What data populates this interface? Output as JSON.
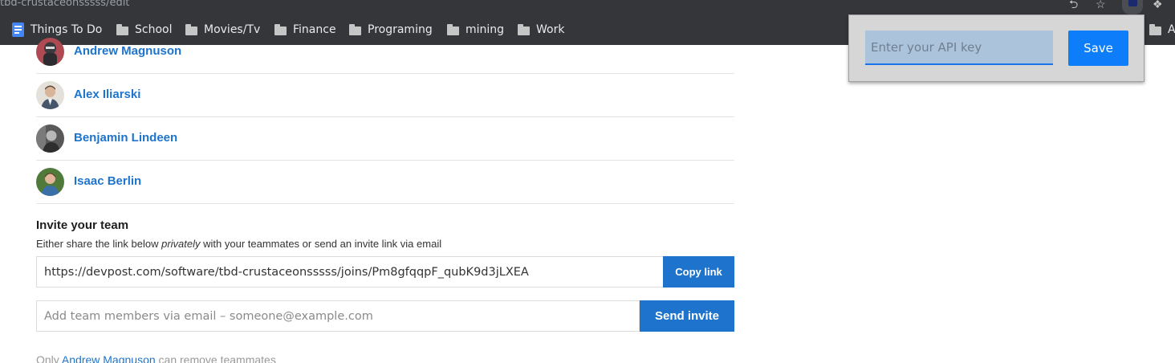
{
  "browser": {
    "url_text": "tbd-crustaceonsssss/edit",
    "bookmarks": [
      {
        "label": "Things To Do",
        "icon": "doc-icon"
      },
      {
        "label": "School",
        "icon": "folder-icon"
      },
      {
        "label": "Movies/Tv",
        "icon": "folder-icon"
      },
      {
        "label": "Finance",
        "icon": "folder-icon"
      },
      {
        "label": "Programing",
        "icon": "folder-icon"
      },
      {
        "label": "mining",
        "icon": "folder-icon"
      },
      {
        "label": "Work",
        "icon": "folder-icon"
      }
    ],
    "overflow_bookmark": "Al",
    "toolbar_icons": [
      "share-icon",
      "star-icon",
      "extension-active-icon",
      "puzzle-icon"
    ]
  },
  "team": {
    "members": [
      {
        "name": "Andrew Magnuson"
      },
      {
        "name": "Alex Iliarski"
      },
      {
        "name": "Benjamin Lindeen"
      },
      {
        "name": "Isaac Berlin"
      }
    ]
  },
  "invite": {
    "title": "Invite your team",
    "desc_before": "Either share the link below ",
    "desc_emphasis": "privately",
    "desc_after": " with your teammates or send an invite link via email",
    "link_value": "https://devpost.com/software/tbd-crustaceonsssss/joins/Pm8gfqqpF_qubK9d3jLXEA",
    "copy_label": "Copy link",
    "email_placeholder": "Add team members via email – someone@example.com",
    "send_label": "Send invite"
  },
  "footnote": {
    "prefix": "Only ",
    "owner": "Andrew Magnuson",
    "suffix": " can remove teammates"
  },
  "popup": {
    "api_placeholder": "Enter your API key",
    "api_value": "",
    "save_label": "Save"
  },
  "colors": {
    "chrome_dark": "#35363a",
    "link_blue": "#1e74cc",
    "popup_button": "#0d7df9"
  }
}
